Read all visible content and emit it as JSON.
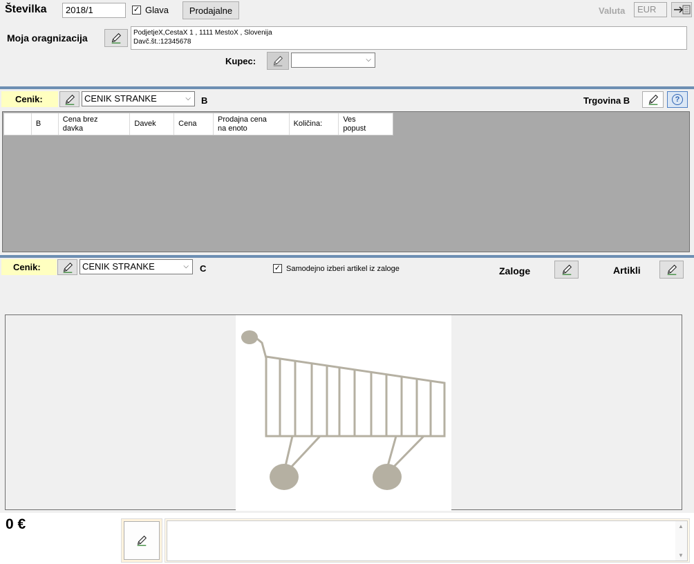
{
  "header": {
    "stevilka_label": "Številka",
    "stevilka_value": "2018/1",
    "glava_checked": true,
    "glava_label": "Glava",
    "prodajalne_button": "Prodajalne",
    "valuta_label": "Valuta",
    "valuta_value": "EUR"
  },
  "organization": {
    "label": "Moja oragnizacija",
    "line1": "PodjetjeX,CestaX 1 , 1111 MestoX , Slovenija",
    "line2": "Davč.št.:12345678",
    "kupec_label": "Kupec:",
    "kupec_value": ""
  },
  "pricelist_b": {
    "cenik_label": "Cenik:",
    "cenik_value": "CENIK STRANKE",
    "letter": "B",
    "trgovina_label": "Trgovina B",
    "help_icon": "?",
    "columns": [
      "",
      "B",
      "Cena brez\ndavka",
      "Davek",
      "Cena",
      "Prodajna cena\nna enoto",
      "Količina:",
      "Ves\npopust"
    ]
  },
  "pricelist_c": {
    "cenik_label": "Cenik:",
    "cenik_value": "CENIK STRANKE",
    "letter": "C",
    "auto_checked": true,
    "auto_label": "Samodejno izberi artikel iz zaloge",
    "zaloge_label": "Zaloge",
    "artikli_label": "Artikli"
  },
  "footer": {
    "total": "0 €",
    "note_value": ""
  },
  "colors": {
    "yellow_label_bg": "#ffffc0",
    "separator": "#6d8fb3",
    "grid_bg": "#a9a9a9",
    "cart": "#b5b0a2"
  },
  "icons": [
    "pencil-icon",
    "checkbox-check-icon",
    "chevron-down-icon",
    "help-icon",
    "exit-icon",
    "shopping-cart-icon",
    "scroll-up-icon",
    "scroll-down-icon"
  ]
}
